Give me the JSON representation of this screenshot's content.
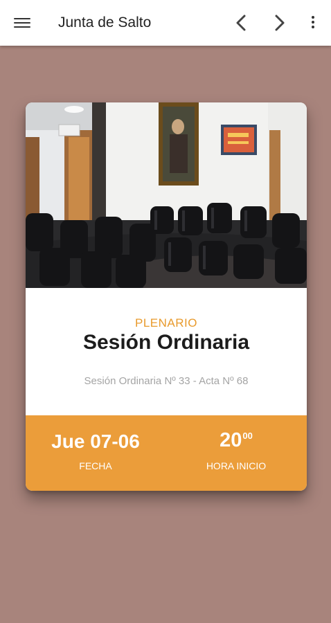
{
  "appbar": {
    "menu_icon": "menu-icon",
    "title": "Junta de Salto",
    "prev_icon": "chevron-left-icon",
    "next_icon": "chevron-right-icon",
    "more_icon": "more-vert-icon"
  },
  "card": {
    "photo_alt": "Sala de sesiones",
    "category": "PLENARIO",
    "title": "Sesión Ordinaria",
    "subtitle": "Sesión Ordinaria Nº 33 - Acta Nº 68",
    "date_value": "Jue 07-06",
    "date_label": "FECHA",
    "time_hour": "20",
    "time_minutes": "00",
    "time_label": "HORA INICIO"
  },
  "colors": {
    "background": "#a8847c",
    "accent": "#eb9d3a",
    "category_text": "#e89a2c"
  }
}
